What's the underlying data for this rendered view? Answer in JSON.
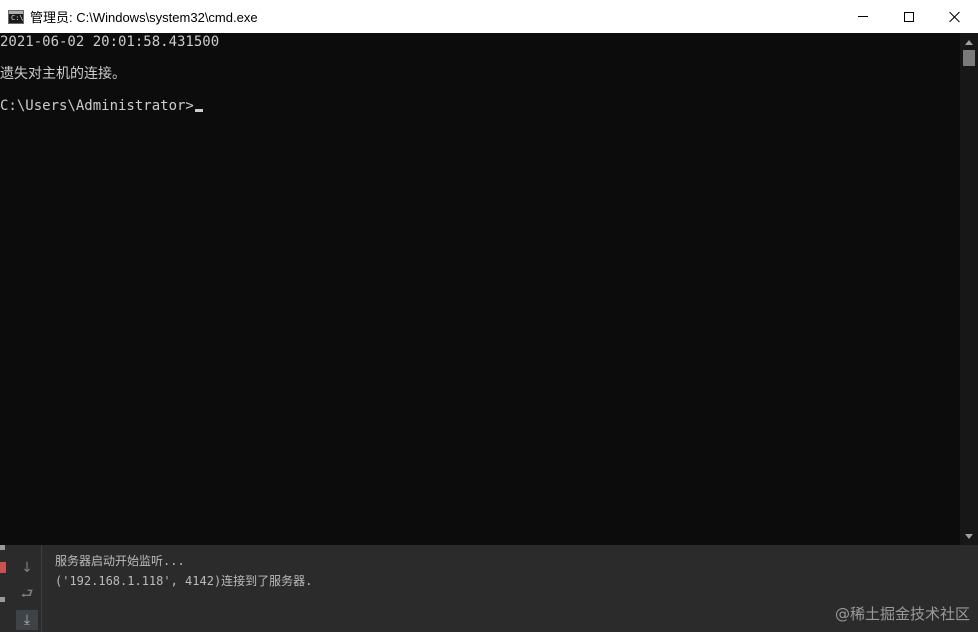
{
  "window": {
    "title": "管理员: C:\\Windows\\system32\\cmd.exe",
    "icon": "cmd-app-icon",
    "icon_glyph": "C:\\"
  },
  "caption_buttons": {
    "minimize": "minimize-icon",
    "maximize": "maximize-icon",
    "close": "close-icon"
  },
  "console": {
    "lines": [
      "2021-06-02 20:01:58.431500",
      "遗失对主机的连接。",
      "C:\\Users\\Administrator>"
    ]
  },
  "run_panel": {
    "tools": [
      "arrow-down-icon",
      "soft-wrap-icon",
      "scroll-to-end-icon"
    ],
    "output": [
      "服务器启动开始监听...",
      "('192.168.1.118', 4142)连接到了服务器."
    ]
  },
  "watermark": "@稀土掘金技术社区",
  "colors": {
    "console_bg": "#0c0c0c",
    "console_text": "#cccccc",
    "panel_bg": "#2b2b2b",
    "stop_red": "#c75450"
  }
}
